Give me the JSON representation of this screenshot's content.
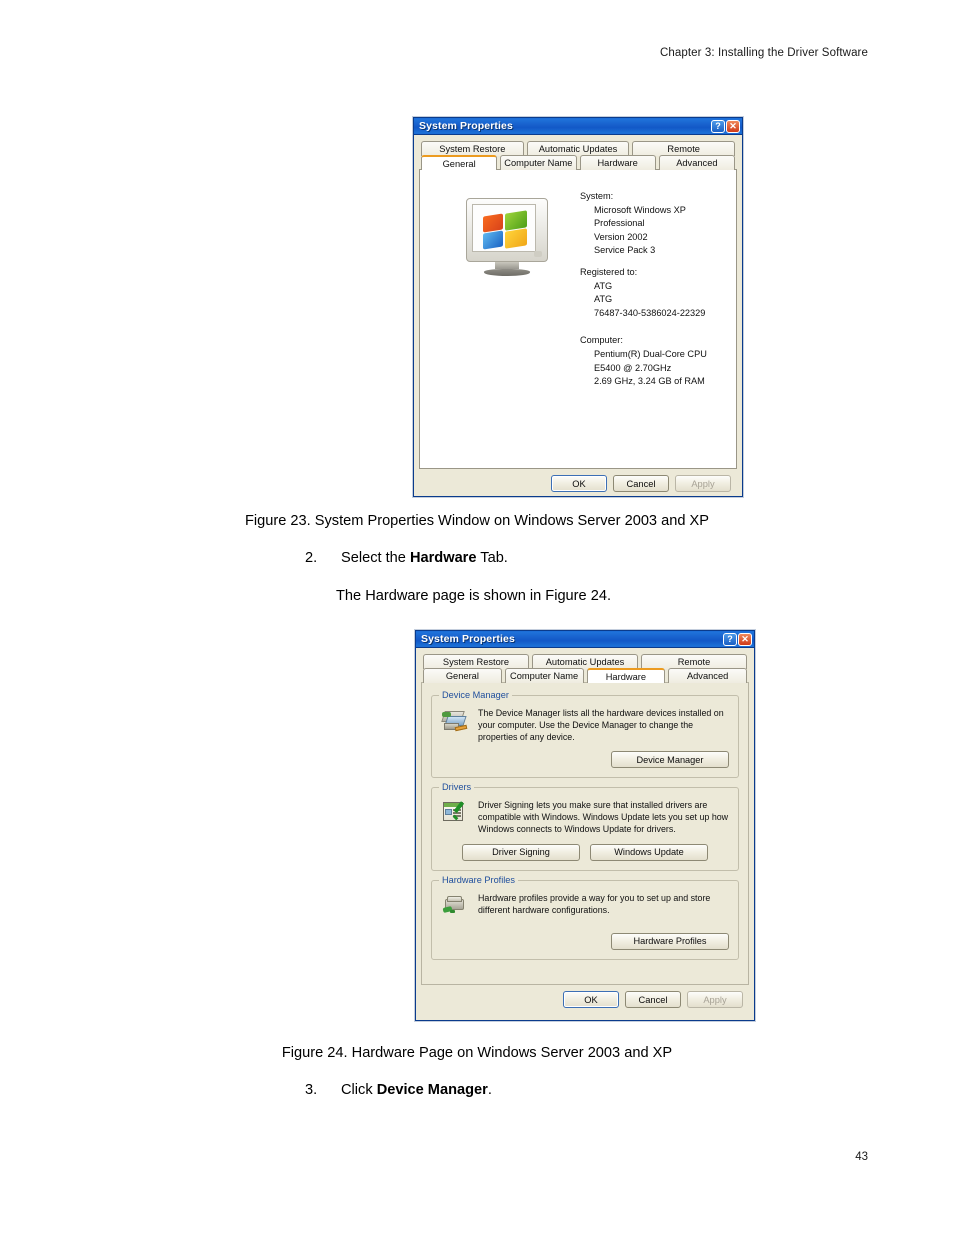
{
  "page": {
    "header": "Chapter 3: Installing the Driver Software",
    "number": "43"
  },
  "figure23": {
    "caption": "Figure 23. System Properties Window on Windows Server 2003 and XP",
    "dialog": {
      "title": "System Properties",
      "titlebar_color": "#1b6bd6",
      "help_button": "?",
      "close_button": "✕",
      "tabs_top": [
        "System Restore",
        "Automatic Updates",
        "Remote"
      ],
      "tabs_bottom": [
        "General",
        "Computer Name",
        "Hardware",
        "Advanced"
      ],
      "active_tab": "General",
      "active_tab_accent": "#ec9b20",
      "general": {
        "system_label": "System:",
        "system_lines": [
          "Microsoft Windows XP",
          "Professional",
          "Version 2002",
          "Service Pack 3"
        ],
        "registered_label": "Registered to:",
        "registered_lines": [
          "ATG",
          "ATG",
          "76487-340-5386024-22329"
        ],
        "computer_label": "Computer:",
        "computer_lines": [
          "Pentium(R) Dual-Core  CPU",
          "E5400  @ 2.70GHz",
          "2.69 GHz, 3.24 GB of RAM"
        ]
      },
      "buttons": {
        "ok": "OK",
        "cancel": "Cancel",
        "apply": "Apply"
      }
    }
  },
  "step2": {
    "number": "2.",
    "text_before": "Select the ",
    "bold": "Hardware",
    "text_after": " Tab.",
    "sub": "The Hardware page is shown in Figure 24."
  },
  "figure24": {
    "caption": "Figure 24. Hardware Page on Windows Server 2003 and XP",
    "dialog": {
      "title": "System Properties",
      "help_button": "?",
      "close_button": "✕",
      "tabs_top": [
        "System Restore",
        "Automatic Updates",
        "Remote"
      ],
      "tabs_bottom": [
        "General",
        "Computer Name",
        "Hardware",
        "Advanced"
      ],
      "active_tab": "Hardware",
      "groups": [
        {
          "legend": "Device Manager",
          "text": "The Device Manager lists all the hardware devices installed on your computer. Use the Device Manager to change the properties of any device.",
          "buttons": [
            "Device Manager"
          ]
        },
        {
          "legend": "Drivers",
          "text": "Driver Signing lets you make sure that installed drivers are compatible with Windows. Windows Update lets you set up how Windows connects to Windows Update for drivers.",
          "buttons": [
            "Driver Signing",
            "Windows Update"
          ]
        },
        {
          "legend": "Hardware Profiles",
          "text": "Hardware profiles provide a way for you to set up and store different hardware configurations.",
          "buttons": [
            "Hardware Profiles"
          ]
        }
      ],
      "buttons": {
        "ok": "OK",
        "cancel": "Cancel",
        "apply": "Apply"
      }
    }
  },
  "step3": {
    "number": "3.",
    "text_before": "Click ",
    "bold": "Device Manager",
    "text_after": "."
  }
}
